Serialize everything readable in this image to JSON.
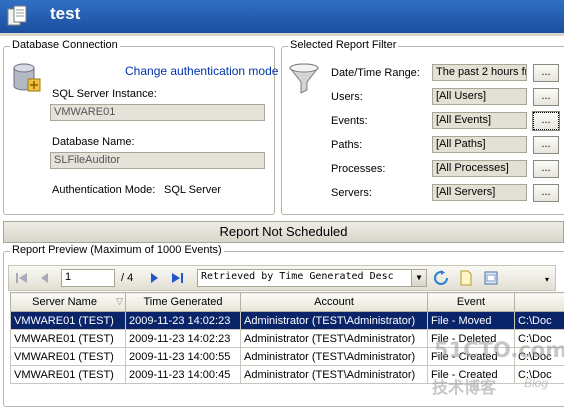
{
  "window": {
    "title": "test"
  },
  "db": {
    "legend": "Database Connection",
    "change_auth_link": "Change authentication mode",
    "sql_instance_label": "SQL Server Instance:",
    "sql_instance_value": "VMWARE01",
    "db_name_label": "Database Name:",
    "db_name_value": "SLFileAuditor",
    "auth_mode_label": "Authentication Mode:",
    "auth_mode_value": "SQL Server"
  },
  "filter": {
    "legend": "Selected Report Filter",
    "browse_label": "...",
    "rows": [
      {
        "label": "Date/Time Range:",
        "value": "The past 2 hours fr"
      },
      {
        "label": "Users:",
        "value": "[All Users]"
      },
      {
        "label": "Events:",
        "value": "[All Events]"
      },
      {
        "label": "Paths:",
        "value": "[All Paths]"
      },
      {
        "label": "Processes:",
        "value": "[All Processes]"
      },
      {
        "label": "Servers:",
        "value": "[All Servers]"
      }
    ]
  },
  "schedule_banner": "Report Not Scheduled",
  "preview": {
    "legend": "Report Preview (Maximum of 1000 Events)",
    "page_current": "1",
    "page_total": "/ 4",
    "sort_text": "Retrieved by Time Generated Desc",
    "columns": [
      "Server Name",
      "Time Generated",
      "Account",
      "Event",
      ""
    ],
    "rows": [
      [
        "VMWARE01 (TEST)",
        "2009-11-23 14:02:23",
        "Administrator  (TEST\\Administrator)",
        "File - Moved",
        "C:\\Doc"
      ],
      [
        "VMWARE01 (TEST)",
        "2009-11-23 14:02:23",
        "Administrator  (TEST\\Administrator)",
        "File - Deleted",
        "C:\\Doc"
      ],
      [
        "VMWARE01 (TEST)",
        "2009-11-23 14:00:55",
        "Administrator  (TEST\\Administrator)",
        "File - Created",
        "C:\\Doc"
      ],
      [
        "VMWARE01 (TEST)",
        "2009-11-23 14:00:45",
        "Administrator  (TEST\\Administrator)",
        "File - Created",
        "C:\\Doc"
      ]
    ]
  },
  "watermark": {
    "main": "51CTO.com",
    "sub": "技术博客",
    "blog": "Blog"
  },
  "colors": {
    "titlebar": "#1c4f9e",
    "selected_row": "#0a246a",
    "link": "#0033aa"
  }
}
